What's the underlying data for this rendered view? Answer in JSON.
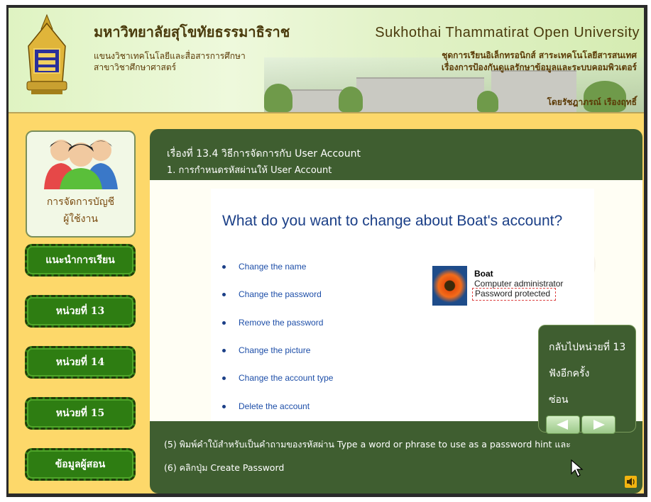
{
  "header": {
    "thai_university": "มหาวิทยาลัยสุโขทัยธรรมาธิราช",
    "thai_dept_line1": "แขนงวิชาเทคโนโลยีและสื่อสารการศึกษา",
    "thai_dept_line2": "สาขาวิชาศึกษาศาสตร์",
    "english_university": "Sukhothai  Thammatirat  Open  University",
    "series_line1": "ชุดการเรียนอิเล็กทรอนิกส์ สาระเทคโนโลยีสารสนเทศ",
    "series_line2": "เรื่องการป้องกันดูแลรักษาข้อมูลและระบบคอมพิวเตอร์",
    "author": "โดยรัชฎาภรณ์ เรืองฤทธิ์"
  },
  "sidebar": {
    "user_label_line1": "การจัดการบัญชี",
    "user_label_line2": "ผู้ใช้งาน",
    "buttons": [
      {
        "label": "แนะนำการเรียน"
      },
      {
        "label": "หน่วยที่ 13"
      },
      {
        "label": "หน่วยที่ 14"
      },
      {
        "label": "หน่วยที่ 15"
      },
      {
        "label": "ข้อมูลผู้สอน"
      }
    ]
  },
  "panel": {
    "title_line1": "เรื่องที่ 13.4 วิธีการจัดการกับ User Account",
    "title_line2": "1. การกำหนดรหัสผ่านให้ User Account",
    "screenshot": {
      "question": "What do you want to change about Boat's account?",
      "options": [
        "Change the name",
        "Change the password",
        "Remove the password",
        "Change the picture",
        "Change the account type",
        "Delete the account"
      ],
      "account_name": "Boat",
      "account_role": "Computer administrator",
      "account_status": "Password protected"
    },
    "side_menu": {
      "back": "กลับไปหน่วยที่ 13",
      "listen_again": "ฟังอีกครั้ง",
      "hide": "ซ่อน"
    },
    "instruction_line1": "(5) พิมพ์คำใบ้สำหรับเป็นคำถามของรหัสผ่าน Type a word or phrase to use as a password hint และ",
    "instruction_line2": "(6) คลิกปุ่ม Create Password"
  },
  "colors": {
    "panel_green": "#3f5e30",
    "nav_green": "#2e7d12",
    "background_yellow": "#fdd86a",
    "link_blue": "#1d4ea8"
  }
}
